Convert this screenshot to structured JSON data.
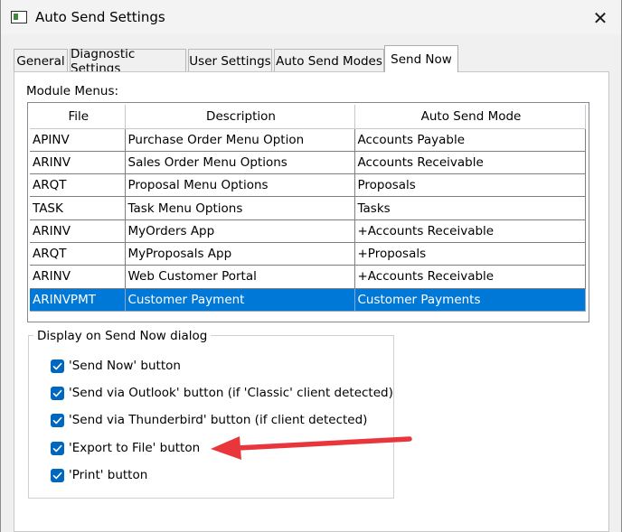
{
  "window": {
    "title": "Auto Send Settings",
    "close_glyph": "✕"
  },
  "tabs": [
    {
      "label": "General",
      "active": false
    },
    {
      "label": "Diagnostic Settings",
      "active": false
    },
    {
      "label": "User Settings",
      "active": false
    },
    {
      "label": "Auto Send Modes",
      "active": false
    },
    {
      "label": "Send Now",
      "active": true
    }
  ],
  "module_menus": {
    "label": "Module Menus:",
    "columns": [
      "File",
      "Description",
      "Auto Send Mode"
    ],
    "rows": [
      {
        "file": "APINV",
        "description": "Purchase Order Menu Option",
        "mode": "Accounts Payable",
        "selected": false
      },
      {
        "file": "ARINV",
        "description": "Sales Order Menu Options",
        "mode": "Accounts Receivable",
        "selected": false
      },
      {
        "file": "ARQT",
        "description": "Proposal Menu Options",
        "mode": "Proposals",
        "selected": false
      },
      {
        "file": "TASK",
        "description": "Task Menu Options",
        "mode": "Tasks",
        "selected": false
      },
      {
        "file": "ARINV",
        "description": "MyOrders App",
        "mode": "+Accounts Receivable",
        "selected": false
      },
      {
        "file": "ARQT",
        "description": "MyProposals App",
        "mode": "+Proposals",
        "selected": false
      },
      {
        "file": "ARINV",
        "description": "Web Customer Portal",
        "mode": "+Accounts Receivable",
        "selected": false
      },
      {
        "file": "ARINVPMT",
        "description": "Customer Payment",
        "mode": "Customer Payments",
        "selected": true
      }
    ]
  },
  "display_group": {
    "legend": "Display on Send Now dialog",
    "options": [
      {
        "label": "'Send Now' button",
        "checked": true
      },
      {
        "label": "'Send via Outlook' button (if 'Classic' client detected)",
        "checked": true
      },
      {
        "label": "'Send via Thunderbird' button (if client detected)",
        "checked": true
      },
      {
        "label": "'Export to File' button",
        "checked": true
      },
      {
        "label": "'Print' button",
        "checked": true
      }
    ]
  },
  "colors": {
    "selection": "#0078d7",
    "checkbox": "#0067c0",
    "annotation_arrow": "#e8363c"
  },
  "icons": {
    "app": "window-app-icon",
    "close": "close-icon",
    "check": "check-icon",
    "annotation": "red-arrow-annotation-icon"
  }
}
